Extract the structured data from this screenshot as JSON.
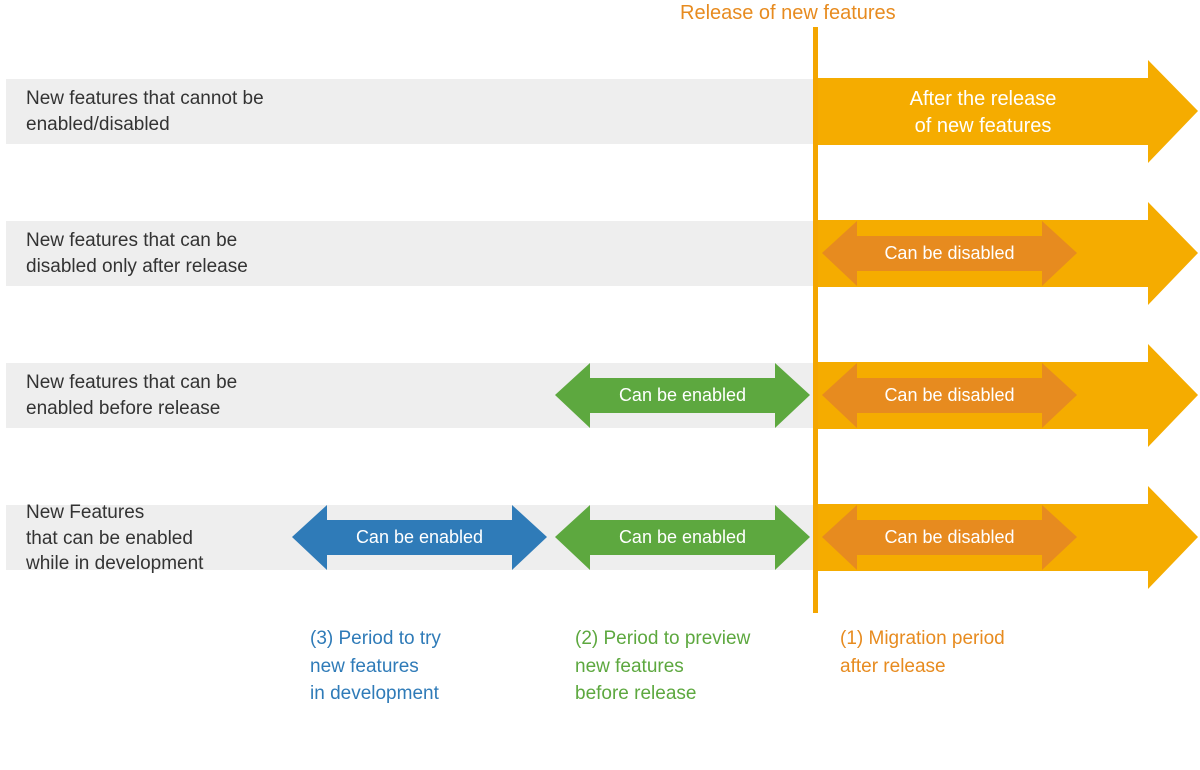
{
  "header": "Release of new features",
  "rows": [
    {
      "label": "New features that cannot be\nenabled/disabled"
    },
    {
      "label": "New features that can be\ndisabled only after release"
    },
    {
      "label": "New features that can be\nenabled before release"
    },
    {
      "label": "New Features\nthat can be enabled\nwhile in development"
    }
  ],
  "yellow_text": "After the release\nof new features",
  "badges": {
    "orange1": "Can be disabled",
    "orange2": "Can be disabled",
    "orange3": "Can be disabled",
    "green1": "Can be enabled",
    "green2": "Can be enabled",
    "blue1": "Can be enabled"
  },
  "footers": {
    "blue": "(3) Period to try\nnew features\nin development",
    "green": "(2) Period to preview\nnew features\nbefore release",
    "orange": "(1) Migration period\nafter release"
  },
  "colors": {
    "yellow": "#f5ac00",
    "orange": "#e78b1f",
    "green": "#5da83f",
    "blue": "#2f7bb8"
  }
}
